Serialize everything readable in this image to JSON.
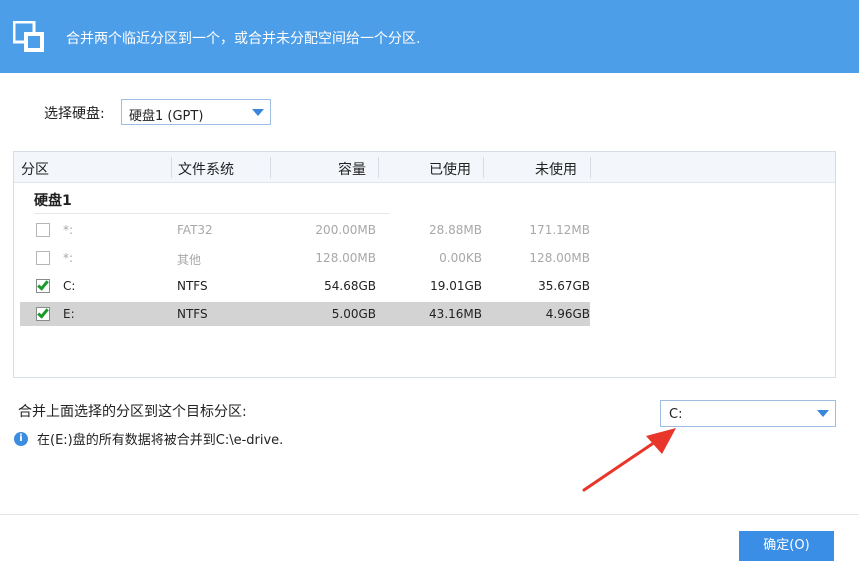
{
  "header": {
    "title": "合并两个临近分区到一个，或合并未分配空间给一个分区."
  },
  "disk_selector": {
    "label": "选择硬盘:",
    "value": "硬盘1 (GPT)"
  },
  "table": {
    "columns": [
      "分区",
      "文件系统",
      "容量",
      "已使用",
      "未使用"
    ],
    "group": "硬盘1",
    "rows": [
      {
        "name": "*:",
        "fs": "FAT32",
        "capacity": "200.00MB",
        "used": "28.88MB",
        "free": "171.12MB",
        "checked": false,
        "enabled": false,
        "selected": false
      },
      {
        "name": "*:",
        "fs": "其他",
        "capacity": "128.00MB",
        "used": "0.00KB",
        "free": "128.00MB",
        "checked": false,
        "enabled": false,
        "selected": false
      },
      {
        "name": "C:",
        "fs": "NTFS",
        "capacity": "54.68GB",
        "used": "19.01GB",
        "free": "35.67GB",
        "checked": true,
        "enabled": true,
        "selected": false
      },
      {
        "name": "E:",
        "fs": "NTFS",
        "capacity": "5.00GB",
        "used": "43.16MB",
        "free": "4.96GB",
        "checked": true,
        "enabled": true,
        "selected": true
      }
    ]
  },
  "merge": {
    "label": "合并上面选择的分区到这个目标分区:",
    "info": "在(E:)盘的所有数据将被合并到C:\\e-drive.",
    "target_value": "C:"
  },
  "footer": {
    "ok_label": "确定(O)"
  },
  "colors": {
    "header_bg": "#4d9ee8",
    "accent": "#3a8ee6",
    "arrow": "#e8362a",
    "check": "#1a9a2a"
  }
}
